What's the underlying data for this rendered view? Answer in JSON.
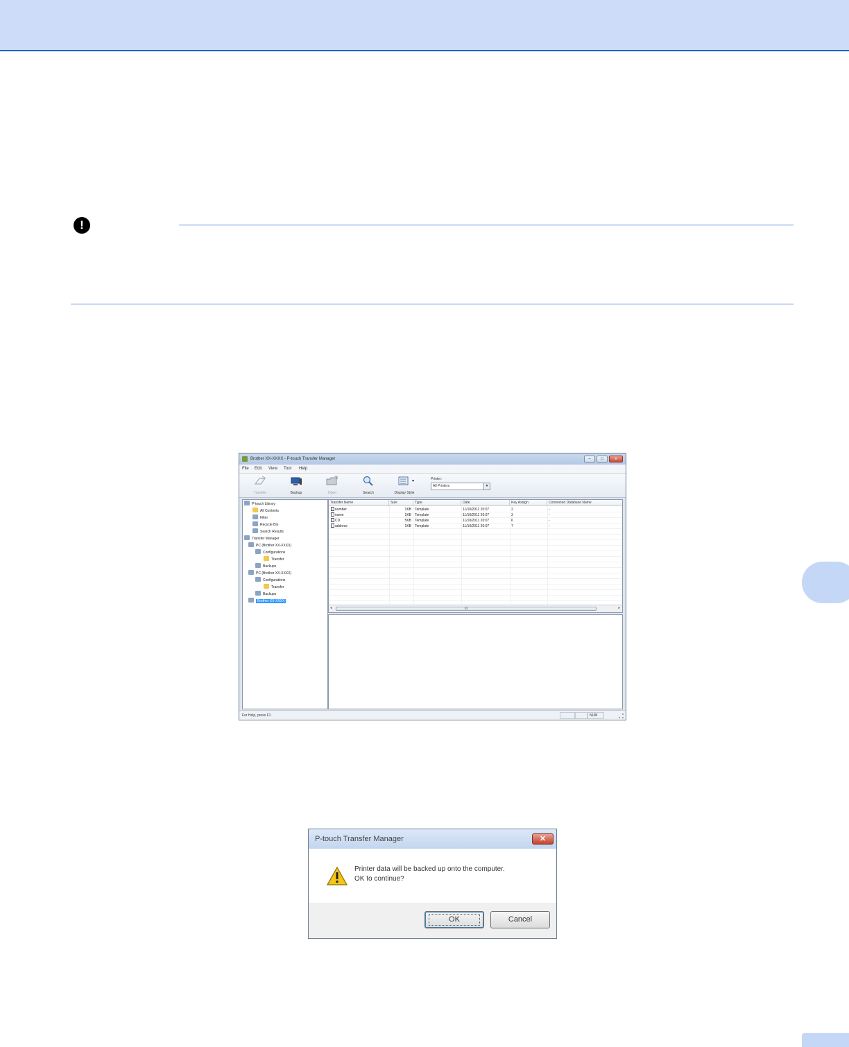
{
  "window": {
    "title": "Brother XX-XXXX - P-touch Transfer Manager",
    "controls": {
      "minimize": "–",
      "maximize": "□",
      "close": "x"
    }
  },
  "menu": [
    "File",
    "Edit",
    "View",
    "Tool",
    "Help"
  ],
  "toolbar": {
    "transfer_label": "Transfer",
    "backup_label": "Backup",
    "open_label": "Open",
    "search_label": "Search",
    "display_style_label": "Display Style",
    "printer_label": "Printer:",
    "printer_value": "All Printers",
    "select_arrow": "▼",
    "display_style_arrow": "▾"
  },
  "tree": [
    "P-touch Library",
    "All Contents",
    "Filter",
    "Recycle Bin",
    "Search Results",
    "Transfer Manager",
    "PC (Brother XX-XXXX)",
    "Configurations",
    "Transfer",
    "Backups",
    "PC (Brother XX-XXXX)",
    "Configurations",
    "Transfer",
    "Backups",
    "Brother XX-XXXX"
  ],
  "list": {
    "columns": [
      "Transfer Name",
      "Size",
      "Type",
      "Date",
      "Key Assign",
      "Connected Database Name"
    ],
    "rows": [
      [
        "number",
        "1KB",
        "Template",
        "11/10/2011 20:07",
        "2",
        "-"
      ],
      [
        "name",
        "1KB",
        "Template",
        "11/10/2011 20:07",
        "3",
        "-"
      ],
      [
        "CD",
        "5KB",
        "Template",
        "11/10/2011 20:07",
        "6",
        "-"
      ],
      [
        "address",
        "1KB",
        "Template",
        "11/10/2011 20:07",
        "7",
        "-"
      ]
    ],
    "scroll_thumb": "III",
    "scroll_left": "◂",
    "scroll_right": "▸"
  },
  "status": {
    "text": "For Help, press F1",
    "num": "NUM"
  },
  "dialog": {
    "title": "P-touch Transfer Manager",
    "close": "✕",
    "message_line1": "Printer data will be backed up onto the computer.",
    "message_line2": "OK to continue?",
    "ok_label": "OK",
    "cancel_label": "Cancel"
  },
  "note": {
    "icon_glyph": "!"
  },
  "colors": {
    "banner": "#ccdcf9",
    "rule": "#5b8ee0",
    "tab": "#c5d7f6"
  }
}
